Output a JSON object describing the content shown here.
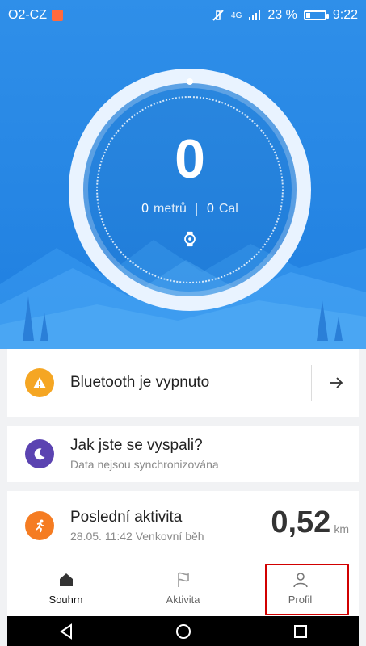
{
  "status": {
    "carrier": "O2-CZ",
    "network": "4G",
    "battery_percent": "23 %",
    "battery_level": 0.23,
    "time": "9:22"
  },
  "hero": {
    "steps": "0",
    "distance_value": "0",
    "distance_unit": "metrů",
    "calories_value": "0",
    "calories_unit": "Cal"
  },
  "cards": {
    "bluetooth": {
      "title": "Bluetooth je vypnuto",
      "icon": "warning-icon",
      "arrow_icon": "arrow-right-icon",
      "badge_color": "#f5a623"
    },
    "sleep": {
      "title": "Jak jste se vyspali?",
      "subtitle": "Data nejsou synchronizována",
      "icon": "moon-icon",
      "badge_color": "#5b43b1"
    },
    "activity": {
      "title": "Poslední aktivita",
      "subtitle": "28.05. 11:42 Venkovní běh",
      "distance": "0,52",
      "unit": "km",
      "icon": "runner-icon",
      "badge_color": "#f57c22"
    }
  },
  "nav": {
    "items": [
      {
        "label": "Souhrn",
        "icon": "home-icon",
        "active": true
      },
      {
        "label": "Aktivita",
        "icon": "flag-icon",
        "active": false
      },
      {
        "label": "Profil",
        "icon": "user-icon",
        "active": false
      }
    ]
  },
  "android_nav": [
    "back-icon",
    "home-circle-icon",
    "recents-icon"
  ],
  "colors": {
    "hero_blue": "#2f8fe9",
    "highlight": "#d10000"
  }
}
